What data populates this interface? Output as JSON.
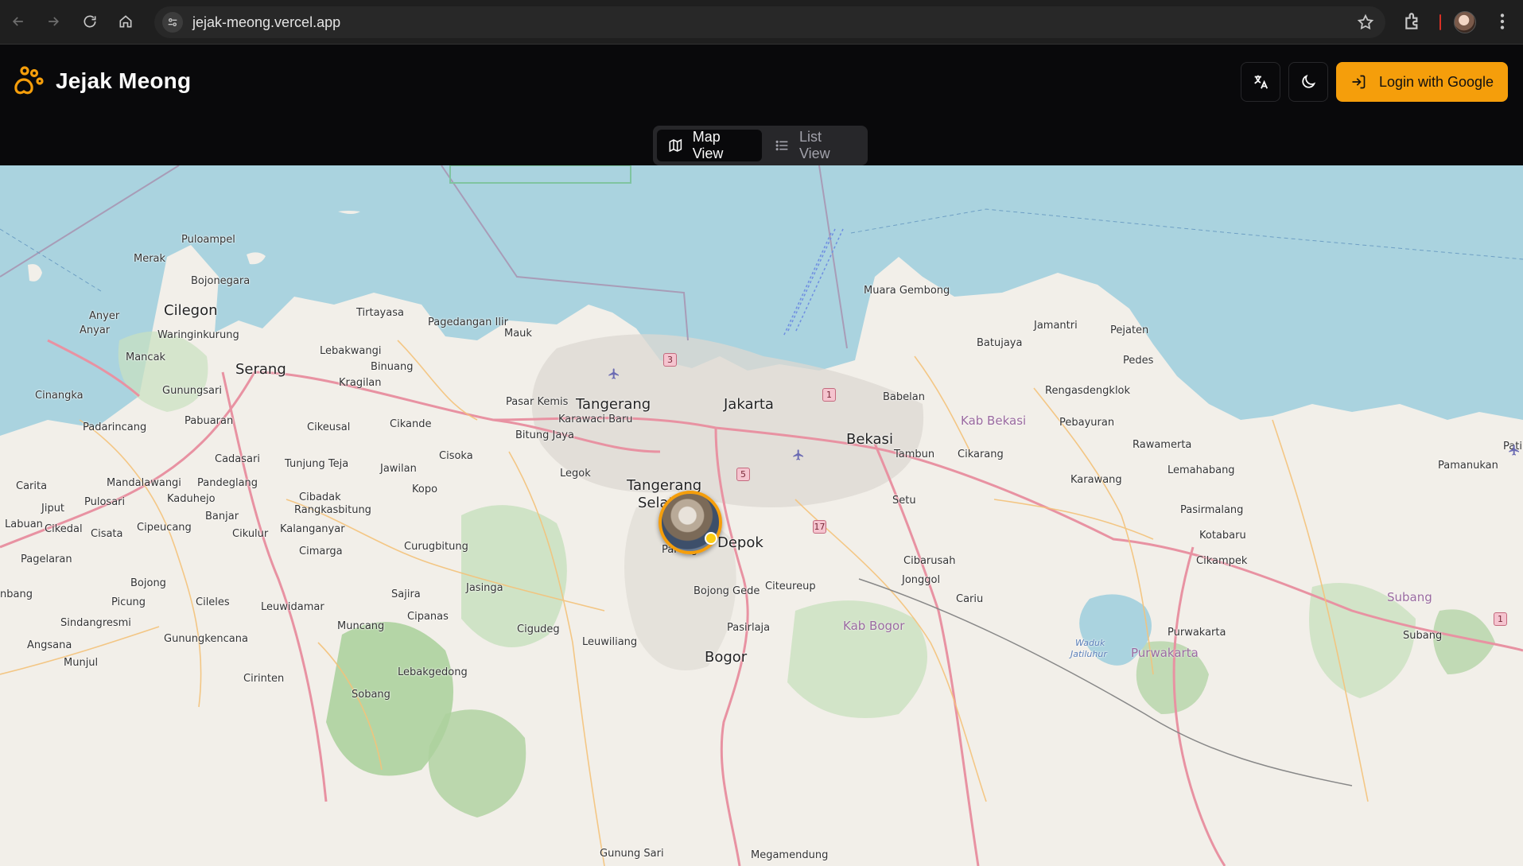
{
  "browser": {
    "url": "jejak-meong.vercel.app"
  },
  "app": {
    "name": "Jejak Meong",
    "accent_color": "#f59e0b",
    "login_label": "Login with Google"
  },
  "view_toggle": {
    "map_label": "Map View",
    "list_label": "List View",
    "active": "Map View"
  },
  "map": {
    "labels": {
      "pulaampel": "Puloampel",
      "merak": "Merak",
      "bojonegara": "Bojonegara",
      "cilegon": "Cilegon",
      "anyer1": "Anyer",
      "anyar": "Anyar",
      "waringinkurung": "Waringinkurung",
      "mancak": "Mancak",
      "serang": "Serang",
      "tirtayasa": "Tirtayasa",
      "pagedangan": "Pagedangan Ilir",
      "mauk": "Mauk",
      "lebakwangi": "Lebakwangi",
      "binuang": "Binuang",
      "kragilan": "Kragilan",
      "cinangka": "Cinangka",
      "gunungsari": "Gunungsari",
      "pabuaran": "Pabuaran",
      "padarincang": "Padarincang",
      "cikeusal": "Cikeusal",
      "cikande": "Cikande",
      "cadasari": "Cadasari",
      "tunjungteja": "Tunjung Teja",
      "jawilan": "Jawilan",
      "cisoka": "Cisoka",
      "kopo": "Kopo",
      "carita": "Carita",
      "mandalawangi": "Mandalawangi",
      "pandeglang": "Pandeglang",
      "kaduhejo": "Kaduhejo",
      "cibadak": "Cibadak",
      "rangkasbitung": "Rangkasbitung",
      "jiput": "Jiput",
      "pulosari": "Pulosari",
      "banjar": "Banjar",
      "labuan": "Labuan",
      "cikedal": "Cikedal",
      "cisata": "Cisata",
      "cipeucang": "Cipeucang",
      "cikulur": "Cikulur",
      "kalanganyar": "Kalanganyar",
      "curugbitung": "Curugbitung",
      "pagelaran": "Pagelaran",
      "cimarga": "Cimarga",
      "bojong": "Bojong",
      "nbang": "nbang",
      "sajira": "Sajira",
      "jasinga": "Jasinga",
      "picung": "Picung",
      "cileles": "Cileles",
      "leuwidamar": "Leuwidamar",
      "sindangresmi": "Sindangresmi",
      "muncang": "Muncang",
      "cipanas": "Cipanas",
      "cigudeg": "Cigudeg",
      "angsana": "Angsana",
      "gunungkencana": "Gunungkencana",
      "munjul": "Munjul",
      "cirinten": "Cirinten",
      "lebakgedong": "Lebakgedong",
      "sobang": "Sobang",
      "leuwiliang": "Leuwiliang",
      "gunungsari2": "Gunung Sari",
      "pasarkemis": "Pasar Kemis",
      "tangerang": "Tangerang",
      "karawacibaru": "Karawaci Baru",
      "bitungjaya": "Bitung Jaya",
      "legok": "Legok",
      "tangerangselatan1": "Tangerang",
      "tangerangselatan2": "Selatan",
      "jakarta": "Jakarta",
      "parung": "Parung",
      "depok": "Depok",
      "bojonggede": "Bojong Gede",
      "citeureup": "Citeureup",
      "pasirlaja": "Pasirlaja",
      "bogor": "Bogor",
      "megamendung": "Megamendung",
      "bekasi": "Bekasi",
      "babelan": "Babelan",
      "tambun": "Tambun",
      "cikarang": "Cikarang",
      "kabbekasi": "Kab Bekasi",
      "setu": "Setu",
      "cibarusah": "Cibarusah",
      "jonggol": "Jonggol",
      "cariu": "Cariu",
      "kabbogor": "Kab Bogor",
      "muaragembong": "Muara Gembong",
      "batujaya": "Batujaya",
      "jamantri": "Jamantri",
      "pejaten": "Pejaten",
      "pedes": "Pedes",
      "rengasdengklok": "Rengasdengklok",
      "pebayuran": "Pebayuran",
      "rawamerta": "Rawamerta",
      "karawang": "Karawang",
      "lemahabang": "Lemahabang",
      "pamanukan": "Pamanukan",
      "pasirmalang": "Pasirmalang",
      "kotabaru": "Kotabaru",
      "cikampek": "Cikampek",
      "purwakarta": "Purwakarta",
      "purwakartaregion": "Purwakarta",
      "waduk": "Waduk",
      "jatiluhur": "Jatiluhur",
      "subang": "Subang",
      "subangregion": "Subang",
      "pati": "Pati"
    },
    "shields": {
      "s3": "3",
      "s1": "1",
      "s5": "5",
      "s17": "17",
      "s1b": "1"
    }
  }
}
